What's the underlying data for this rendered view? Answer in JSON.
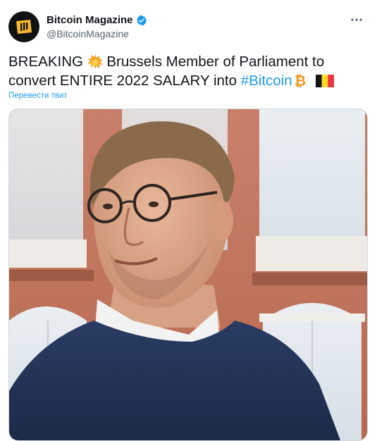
{
  "account": {
    "display_name": "Bitcoin Magazine",
    "handle": "@BitcoinMagazine",
    "verified": true
  },
  "tweet": {
    "breaking": "BREAKING",
    "text_part1": " Brussels Member of Parliament to convert ENTIRE 2022 SALARY into ",
    "hashtag": "#Bitcoin",
    "emojis": [
      "collision-icon",
      "bitcoin-icon",
      "belgium-flag-icon"
    ]
  },
  "translate_link": "Перевести твит",
  "more_icon": "more-dots-icon",
  "colors": {
    "link": "#1d9bf0",
    "verified": "#1d9bf0",
    "bitcoin": "#f7931a",
    "text": "#0f1419",
    "secondary": "#536471"
  }
}
